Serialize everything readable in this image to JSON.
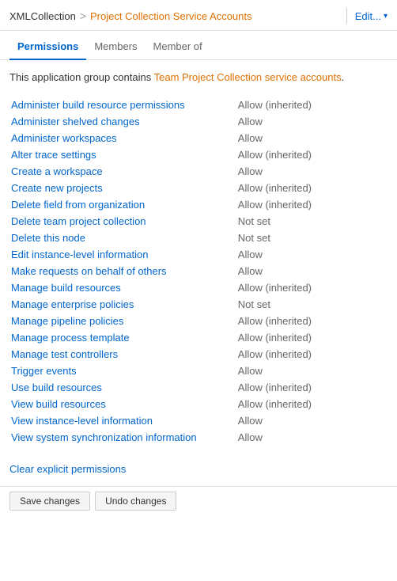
{
  "header": {
    "collection": "XMLCollection",
    "separator": ">",
    "current": "Project Collection Service Accounts",
    "edit_label": "Edit...",
    "chevron": "▾"
  },
  "tabs": [
    {
      "label": "Permissions",
      "active": true
    },
    {
      "label": "Members",
      "active": false
    },
    {
      "label": "Member of",
      "active": false
    }
  ],
  "description": {
    "prefix": "This application group contains ",
    "highlight": "Team Project Collection service accounts",
    "suffix": "."
  },
  "permissions": [
    {
      "name": "Administer build resource permissions",
      "value": "Allow (inherited)",
      "type": "allow-inherited"
    },
    {
      "name": "Administer shelved changes",
      "value": "Allow",
      "type": "allow"
    },
    {
      "name": "Administer workspaces",
      "value": "Allow",
      "type": "allow"
    },
    {
      "name": "Alter trace settings",
      "value": "Allow (inherited)",
      "type": "allow-inherited"
    },
    {
      "name": "Create a workspace",
      "value": "Allow",
      "type": "allow"
    },
    {
      "name": "Create new projects",
      "value": "Allow (inherited)",
      "type": "allow-inherited"
    },
    {
      "name": "Delete field from organization",
      "value": "Allow (inherited)",
      "type": "allow-inherited"
    },
    {
      "name": "Delete team project collection",
      "value": "Not set",
      "type": "not-set"
    },
    {
      "name": "Delete this node",
      "value": "Not set",
      "type": "not-set"
    },
    {
      "name": "Edit instance-level information",
      "value": "Allow",
      "type": "allow"
    },
    {
      "name": "Make requests on behalf of others",
      "value": "Allow",
      "type": "allow"
    },
    {
      "name": "Manage build resources",
      "value": "Allow (inherited)",
      "type": "allow-inherited"
    },
    {
      "name": "Manage enterprise policies",
      "value": "Not set",
      "type": "not-set"
    },
    {
      "name": "Manage pipeline policies",
      "value": "Allow (inherited)",
      "type": "allow-inherited"
    },
    {
      "name": "Manage process template",
      "value": "Allow (inherited)",
      "type": "allow-inherited"
    },
    {
      "name": "Manage test controllers",
      "value": "Allow (inherited)",
      "type": "allow-inherited"
    },
    {
      "name": "Trigger events",
      "value": "Allow",
      "type": "allow"
    },
    {
      "name": "Use build resources",
      "value": "Allow (inherited)",
      "type": "allow-inherited"
    },
    {
      "name": "View build resources",
      "value": "Allow (inherited)",
      "type": "allow-inherited"
    },
    {
      "name": "View instance-level information",
      "value": "Allow",
      "type": "allow"
    },
    {
      "name": "View system synchronization information",
      "value": "Allow",
      "type": "allow"
    }
  ],
  "footer": {
    "clear_label": "Clear explicit permissions"
  },
  "bottom_buttons": [
    {
      "label": "Save changes"
    },
    {
      "label": "Undo changes"
    }
  ]
}
